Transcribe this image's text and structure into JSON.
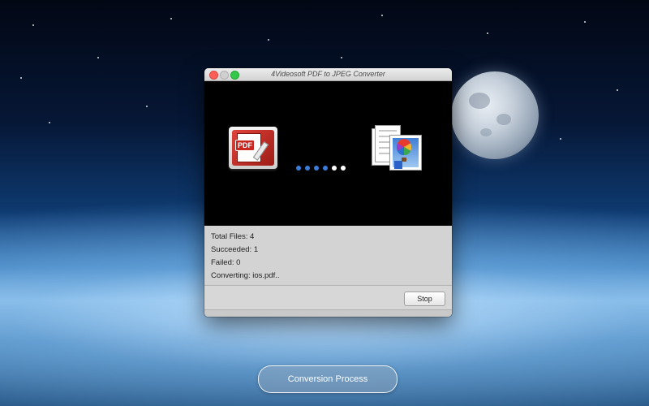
{
  "window": {
    "title": "4Videosoft PDF to JPEG Converter"
  },
  "conversion": {
    "source_icon": "pdf-file-icon",
    "source_label": "PDF",
    "target_icon": "jpeg-image-icon",
    "progress_dots": {
      "total": 6,
      "active": 4
    },
    "colors": {
      "active_dot": "#3b7ddb",
      "inactive_dot": "#ffffff"
    }
  },
  "stats": {
    "total_files_label": "Total Files:",
    "total_files_value": "4",
    "succeeded_label": "Succeeded:",
    "succeeded_value": "1",
    "failed_label": "Failed:",
    "failed_value": "0",
    "converting_label": "Converting:",
    "converting_value": "ios.pdf.."
  },
  "footer": {
    "stop_label": "Stop"
  },
  "caption": {
    "label": "Conversion Process"
  }
}
